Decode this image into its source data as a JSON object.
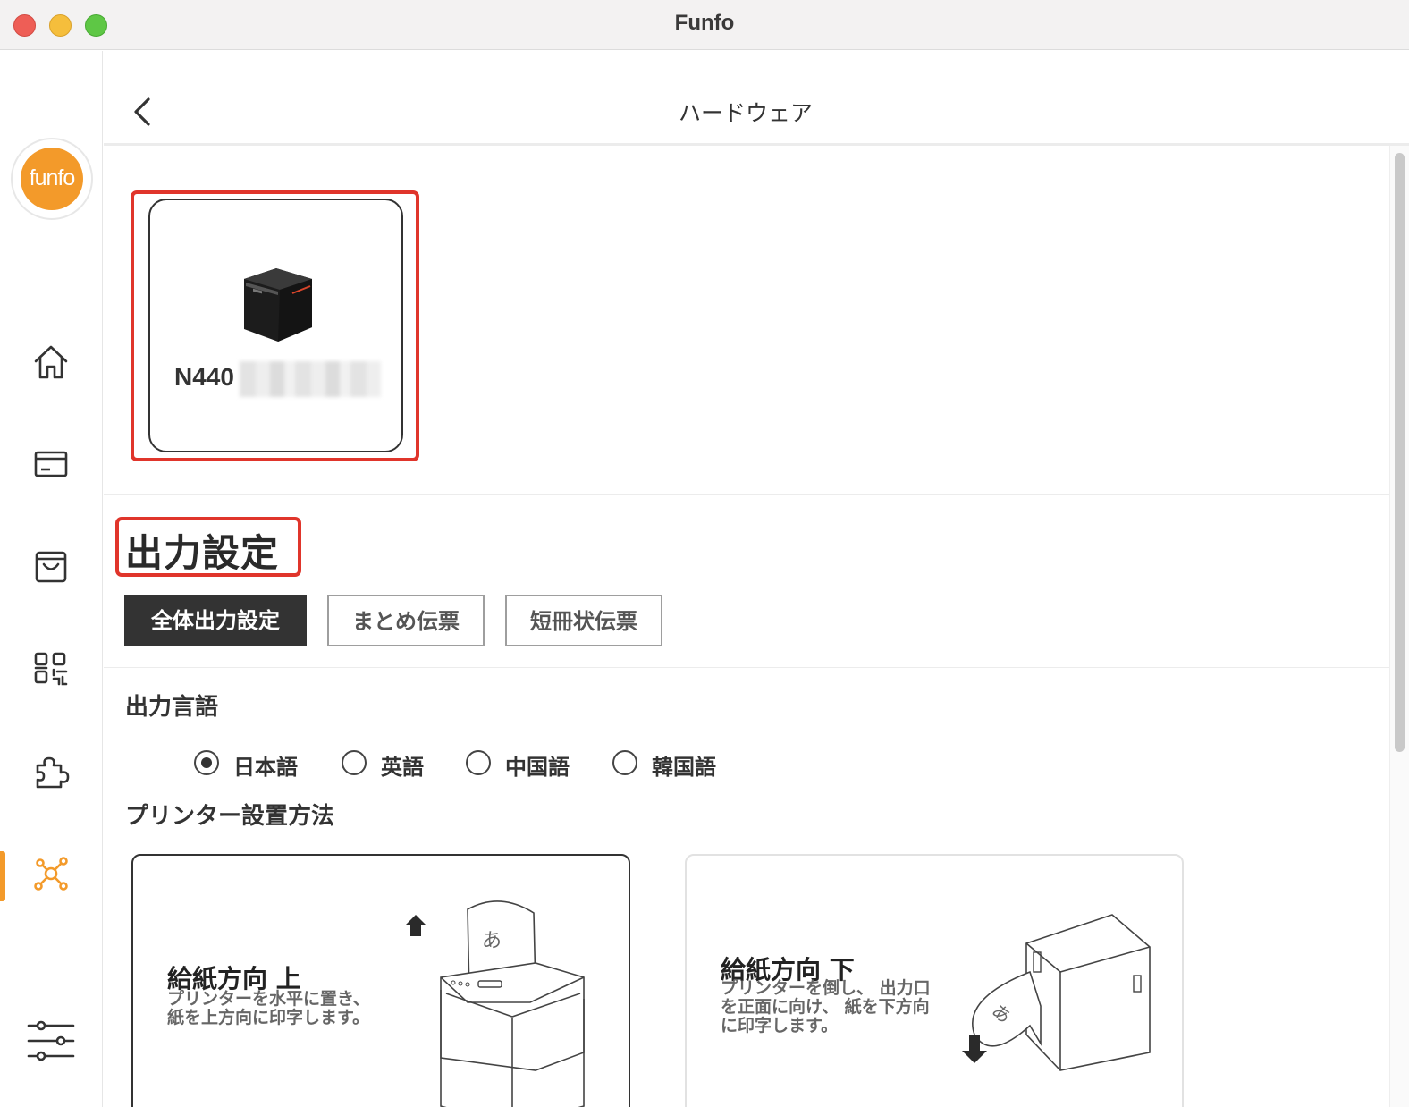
{
  "window": {
    "title": "Funfo"
  },
  "sidebar": {
    "logo_text": "funfo",
    "active_item": "hardware",
    "accent_color": "#f39a2a",
    "items": [
      {
        "icon": "home-icon"
      },
      {
        "icon": "card-icon"
      },
      {
        "icon": "shopping-bag-icon"
      },
      {
        "icon": "qr-code-icon"
      },
      {
        "icon": "puzzle-icon"
      },
      {
        "icon": "hardware-network-icon"
      },
      {
        "icon": "sliders-icon"
      }
    ]
  },
  "header": {
    "back_icon": "chevron-left-icon",
    "title": "ハードウェア"
  },
  "device": {
    "name": "N440",
    "name_obscured": true
  },
  "output_settings": {
    "heading": "出力設定",
    "tabs": [
      {
        "label": "全体出力設定",
        "active": true
      },
      {
        "label": "まとめ伝票",
        "active": false
      },
      {
        "label": "短冊状伝票",
        "active": false
      }
    ]
  },
  "language": {
    "heading": "出力言語",
    "options": [
      {
        "label": "日本語",
        "selected": true
      },
      {
        "label": "英語",
        "selected": false
      },
      {
        "label": "中国語",
        "selected": false
      },
      {
        "label": "韓国語",
        "selected": false
      }
    ]
  },
  "installation": {
    "heading": "プリンター設置方法",
    "options": [
      {
        "title": "給紙方向 上",
        "desc_line1": "プリンターを水平に置き、",
        "desc_line2": "紙を上方向に印字します。",
        "paper_char": "あ",
        "selected": true
      },
      {
        "title": "給紙方向 下",
        "desc_line1": "プリンターを倒し、 出力口",
        "desc_line2": "を正面に向け、 紙を下方向",
        "desc_line3": "に印字します。",
        "paper_char": "あ",
        "selected": false
      }
    ]
  },
  "highlight_color": "#e0352b"
}
